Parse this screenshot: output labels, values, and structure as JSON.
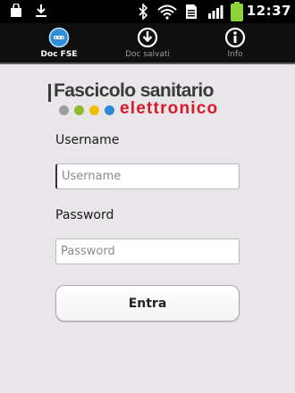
{
  "status_bar": {
    "time": "12:37",
    "icons": [
      "shopping-bag-icon",
      "download-icon",
      "bluetooth-icon",
      "wifi-icon",
      "sim-icon",
      "signal-icon",
      "battery-icon"
    ]
  },
  "tabs": [
    {
      "label": "Doc FSE",
      "icon": "fse-icon",
      "active": true
    },
    {
      "label": "Doc salvati",
      "icon": "download-circle-icon",
      "active": false
    },
    {
      "label": "Info",
      "icon": "info-icon",
      "active": false
    }
  ],
  "logo": {
    "line1": "Fascicolo sanitario",
    "line2": "elettronico",
    "dot_colors": [
      "#9c9c9c",
      "#8dbb2a",
      "#f0c000",
      "#2a8ad4"
    ]
  },
  "form": {
    "username_label": "Username",
    "username_placeholder": "Username",
    "password_label": "Password",
    "password_placeholder": "Password",
    "submit_label": "Entra"
  }
}
